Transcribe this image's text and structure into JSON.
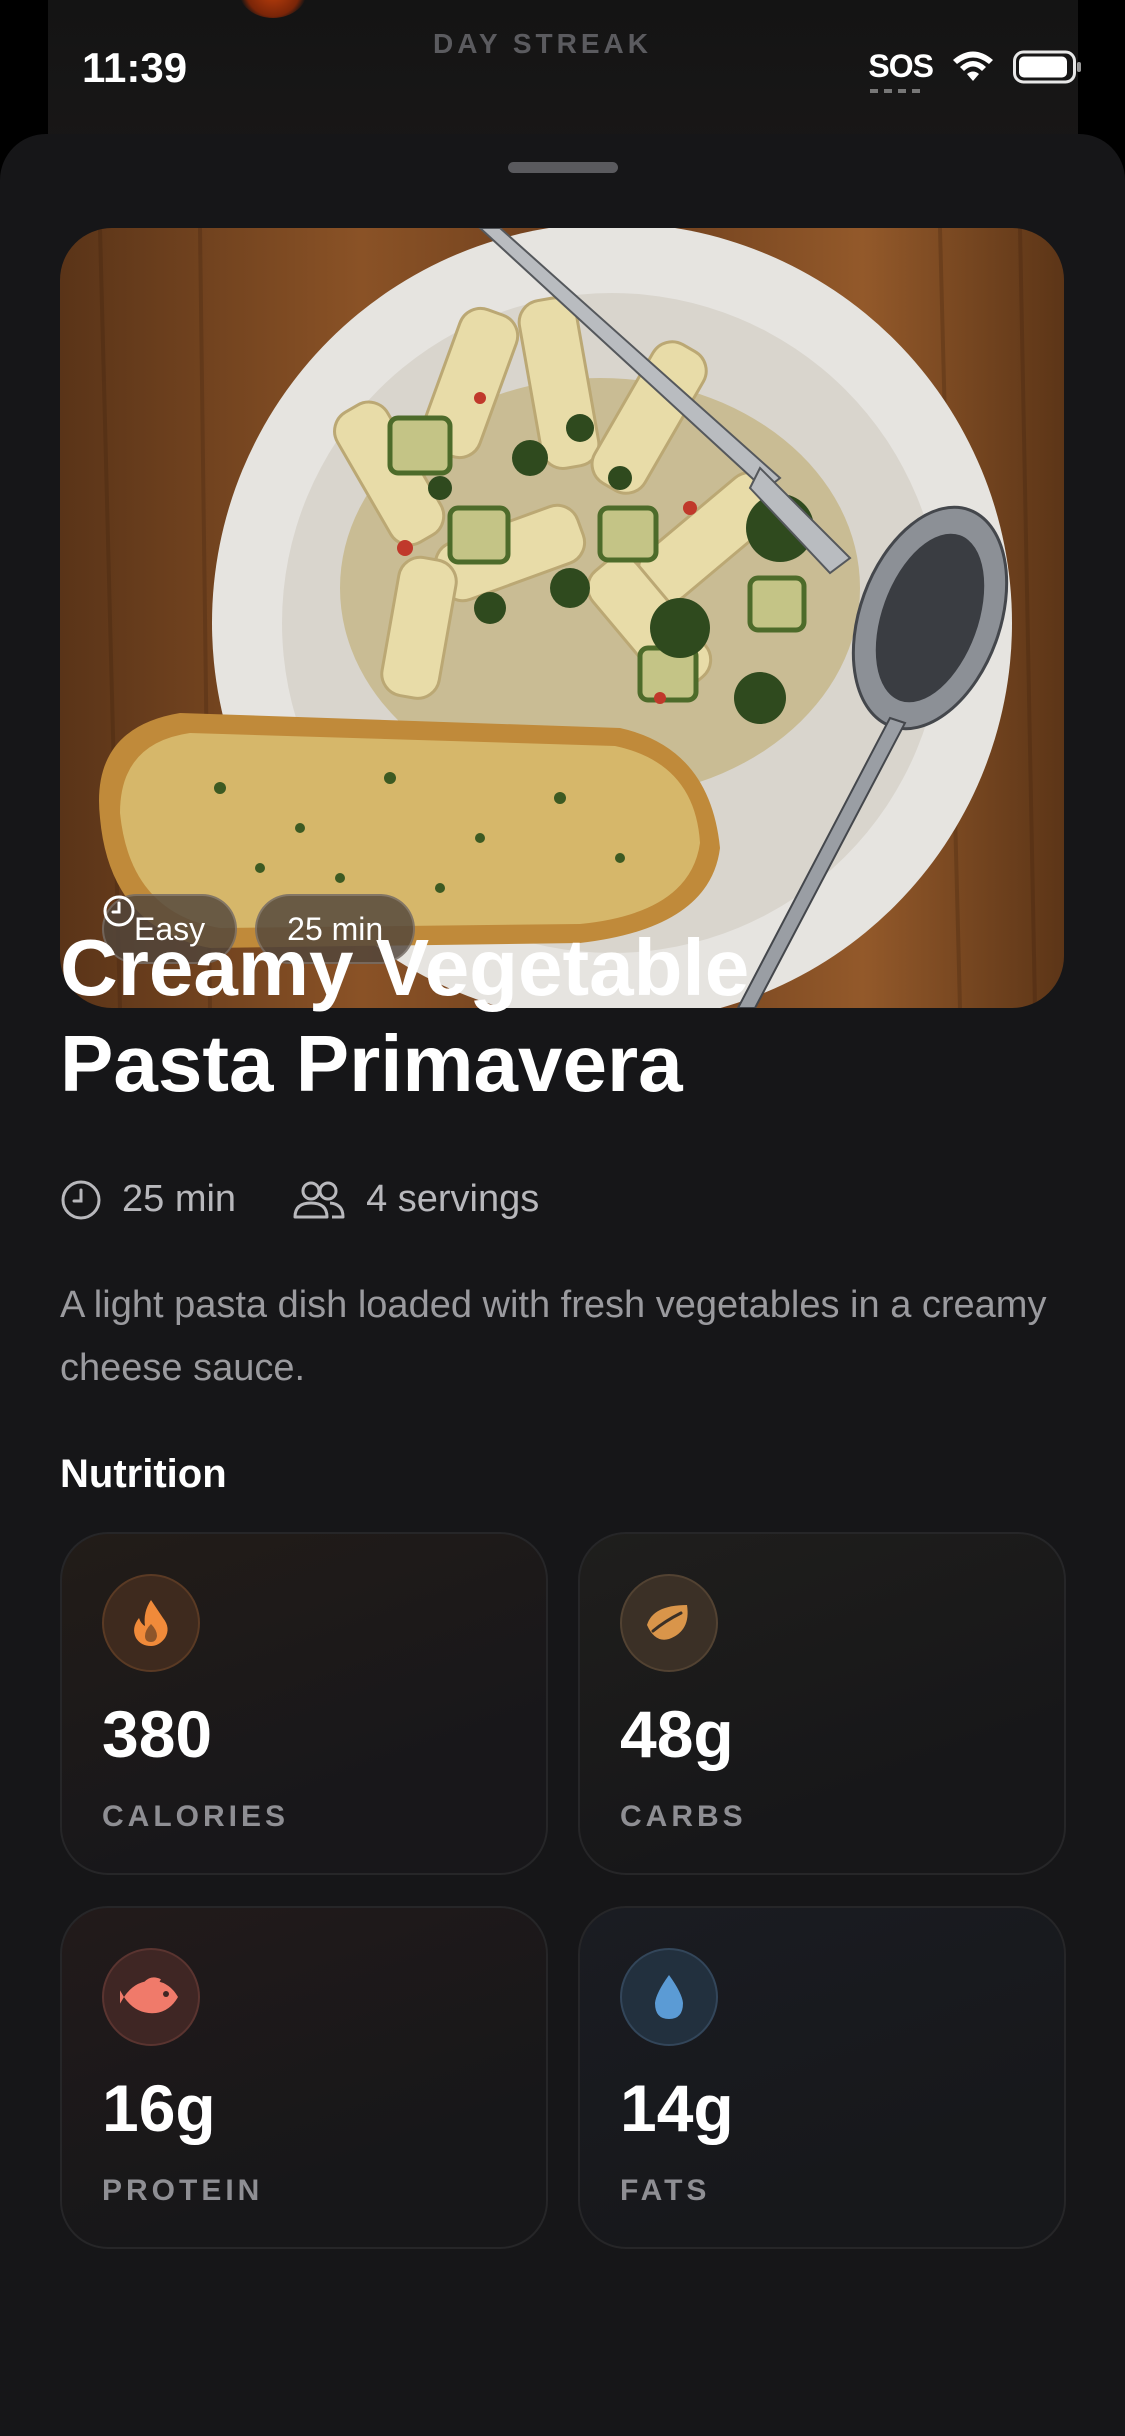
{
  "status_bar": {
    "time": "11:39",
    "sos": "SOS"
  },
  "background": {
    "label": "DAY STREAK"
  },
  "recipe": {
    "difficulty": "Easy",
    "time_badge": "25 min",
    "title_line1": "Creamy Vegetable",
    "title_line2": "Pasta Primavera",
    "time": "25 min",
    "servings": "4 servings",
    "description": "A light pasta dish loaded with fresh vegetables in a creamy cheese sauce."
  },
  "nutrition": {
    "title": "Nutrition",
    "items": [
      {
        "value": "380",
        "label": "CALORIES",
        "icon": "flame-icon",
        "color": "#f08a3a"
      },
      {
        "value": "48g",
        "label": "CARBS",
        "icon": "leaf-icon",
        "color": "#d9954a"
      },
      {
        "value": "16g",
        "label": "PROTEIN",
        "icon": "fish-icon",
        "color": "#f07a6a"
      },
      {
        "value": "14g",
        "label": "FATS",
        "icon": "drop-icon",
        "color": "#5b9bd5"
      }
    ]
  }
}
